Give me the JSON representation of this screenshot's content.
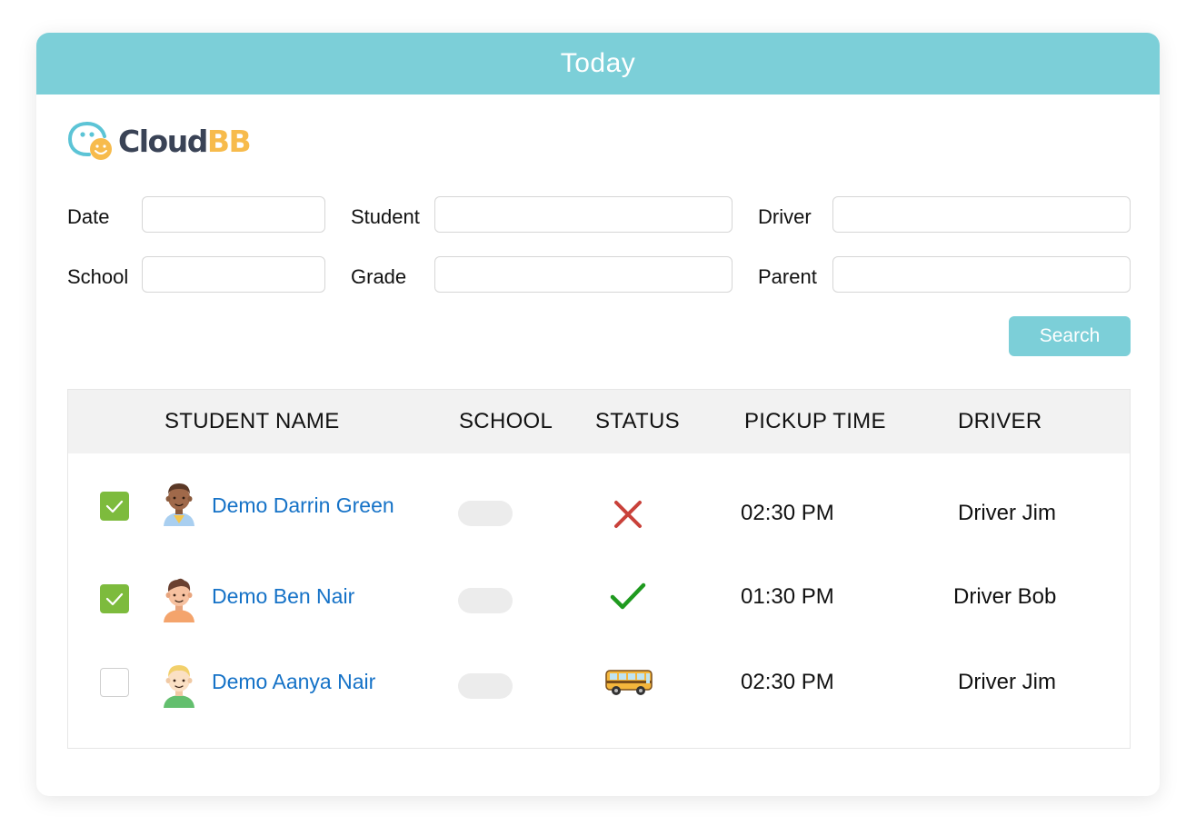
{
  "header": {
    "title": "Today"
  },
  "brand": {
    "part1": "Cloud",
    "part2": "BB"
  },
  "filters": {
    "date_label": "Date",
    "student_label": "Student",
    "driver_label": "Driver",
    "school_label": "School",
    "grade_label": "Grade",
    "parent_label": "Parent",
    "date_value": "",
    "student_value": "",
    "driver_value": "",
    "school_value": "",
    "grade_value": "",
    "parent_value": ""
  },
  "search": {
    "label": "Search"
  },
  "table": {
    "columns": [
      "STUDENT NAME",
      "SCHOOL",
      "STATUS",
      "PICKUP TIME",
      "DRIVER"
    ],
    "rows": [
      {
        "checked": true,
        "avatar": "dark-skin-curly-hair-avatar",
        "name": "Demo Darrin Green",
        "school": "",
        "status": "cross-icon",
        "pickup_time": "02:30 PM",
        "driver": "Driver Jim"
      },
      {
        "checked": true,
        "avatar": "brown-hair-boy-avatar",
        "name": "Demo Ben Nair",
        "school": "",
        "status": "check-icon",
        "pickup_time": "01:30 PM",
        "driver": "Driver Bob"
      },
      {
        "checked": false,
        "avatar": "blonde-hair-kid-avatar",
        "name": "Demo Aanya Nair",
        "school": "",
        "status": "school-bus-icon",
        "pickup_time": "02:30 PM",
        "driver": "Driver Jim"
      }
    ]
  },
  "colors": {
    "accent": "#7ccfd8",
    "link": "#1572c7",
    "checkbox_checked": "#7dbb3d",
    "status_cross": "#c9413a",
    "status_check": "#1f9a1f",
    "brand_dark": "#3a4356",
    "brand_yellow": "#f7bb4c"
  }
}
